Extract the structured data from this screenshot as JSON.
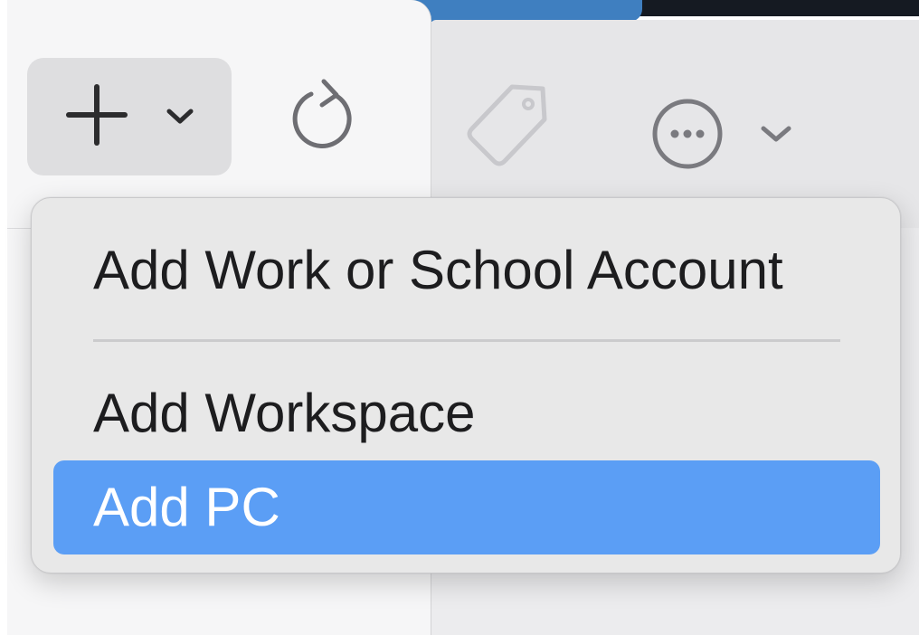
{
  "toolbar": {
    "add_button_icon": "plus-icon",
    "add_menu_chevron_icon": "chevron-down-icon",
    "refresh_icon": "refresh-icon",
    "tag_icon": "tag-icon",
    "more_icon": "ellipsis-circle-icon",
    "more_menu_chevron_icon": "chevron-down-icon"
  },
  "add_menu": {
    "items": [
      {
        "label": "Add Work or School Account",
        "highlighted": false
      },
      {
        "label": "Add Workspace",
        "highlighted": false
      },
      {
        "label": "Add PC",
        "highlighted": true
      }
    ]
  },
  "colors": {
    "highlight": "#5b9ef5",
    "menu_background": "#e8e8e8",
    "menu_text": "#1d1d1f",
    "highlight_text": "#ffffff"
  }
}
